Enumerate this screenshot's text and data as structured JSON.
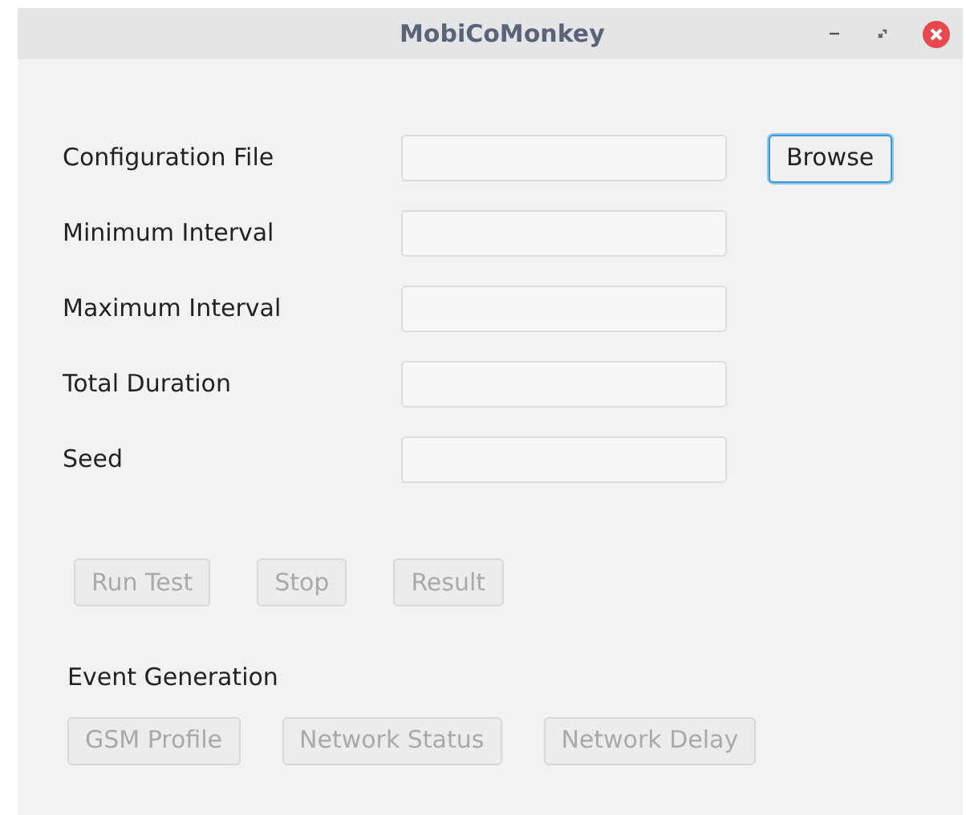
{
  "window": {
    "title": "MobiCoMonkey"
  },
  "fields": [
    {
      "label": "Configuration File",
      "button": {
        "label": "Browse",
        "disabled": false,
        "focused": true
      }
    },
    {
      "label": "Minimum Interval"
    },
    {
      "label": "Maximum Interval"
    },
    {
      "label": "Total Duration"
    },
    {
      "label": "Seed"
    }
  ],
  "actions": [
    {
      "label": "Run Test",
      "disabled": true
    },
    {
      "label": "Stop",
      "disabled": true
    },
    {
      "label": "Result",
      "disabled": true
    }
  ],
  "event_generation": {
    "heading": "Event Generation",
    "buttons": [
      {
        "label": "GSM Profile",
        "disabled": true
      },
      {
        "label": "Network Status",
        "disabled": true
      },
      {
        "label": "Network Delay",
        "disabled": true
      }
    ]
  }
}
